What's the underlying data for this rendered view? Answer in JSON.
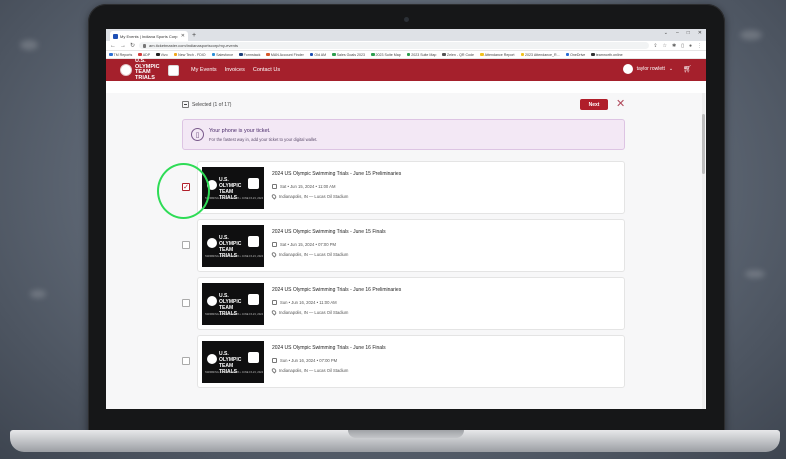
{
  "browser": {
    "tab_title": "My Events | Indiana Sports Corp",
    "new_tab": "+",
    "url": "am.ticketmaster.com/indianasportscorp/my-events",
    "bookmarks": [
      {
        "label": "TM Reports",
        "color": "#2b6fd6"
      },
      {
        "label": "ADP",
        "color": "#d23c3c"
      },
      {
        "label": "Vivo",
        "color": "#222222"
      },
      {
        "label": "New Tech - FDIO",
        "color": "#f0a81e"
      },
      {
        "label": "Salesforce",
        "color": "#2b8fd6"
      },
      {
        "label": "Formstack",
        "color": "#1d3f7a"
      },
      {
        "label": "MAN Account Finder",
        "color": "#d65a2b"
      },
      {
        "label": "Old AM",
        "color": "#1d4fb5"
      },
      {
        "label": "Sales Goals 2023",
        "color": "#2e9e4f"
      },
      {
        "label": "2023 Suite Map",
        "color": "#2e9e4f"
      },
      {
        "label": "2023 Suite Map",
        "color": "#2e9e4f"
      },
      {
        "label": "Zelen - QR Code",
        "color": "#555555"
      },
      {
        "label": "Attendance Report",
        "color": "#f0c21e"
      },
      {
        "label": "2023 Attendance_R...",
        "color": "#f0c21e"
      },
      {
        "label": "OneDrive",
        "color": "#2b6fd6"
      },
      {
        "label": "teamnorth.online",
        "color": "#333333"
      }
    ]
  },
  "site": {
    "logo_text": "U.S. OLYMPIC TEAM TRIALS",
    "nav": [
      "My Events",
      "Invoices",
      "Contact Us"
    ],
    "user_name": "taylor rowlett",
    "user_caret": "⌄",
    "cart_icon": "cart-icon"
  },
  "selection": {
    "label": "Selected (1 of 17)",
    "next_label": "Next",
    "close_glyph": "✕"
  },
  "banner": {
    "title": "Your phone is your ticket.",
    "subtitle": "For the fastest way in, add your ticket to your digital wallet."
  },
  "events": [
    {
      "title": "2024 US Olympic Swimming Trials - June 15 Preliminaries",
      "date": "Sat • Jun 15, 2024 • 11:00 AM",
      "venue": "Indianapolis, IN — Lucas Oil Stadium",
      "checked": true
    },
    {
      "title": "2024 US Olympic Swimming Trials - June 15 Finals",
      "date": "Sat • Jun 15, 2024 • 07:00 PM",
      "venue": "Indianapolis, IN — Lucas Oil Stadium",
      "checked": false
    },
    {
      "title": "2024 US Olympic Swimming Trials - June 16 Preliminaries",
      "date": "Sun • Jun 16, 2024 • 11:00 AM",
      "venue": "Indianapolis, IN — Lucas Oil Stadium",
      "checked": false
    },
    {
      "title": "2024 US Olympic Swimming Trials - June 16 Finals",
      "date": "Sun • Jun 16, 2024 • 07:00 PM",
      "venue": "Indianapolis, IN — Lucas Oil Stadium",
      "checked": false
    }
  ],
  "thumb": {
    "text": "U.S. OLYMPIC TEAM TRIALS",
    "footer": "SWIMMING • INDIANAPOLIS • JUNE 15-23, 2024"
  },
  "colors": {
    "brand_red": "#a5202c",
    "highlight_green": "#2edc56"
  }
}
